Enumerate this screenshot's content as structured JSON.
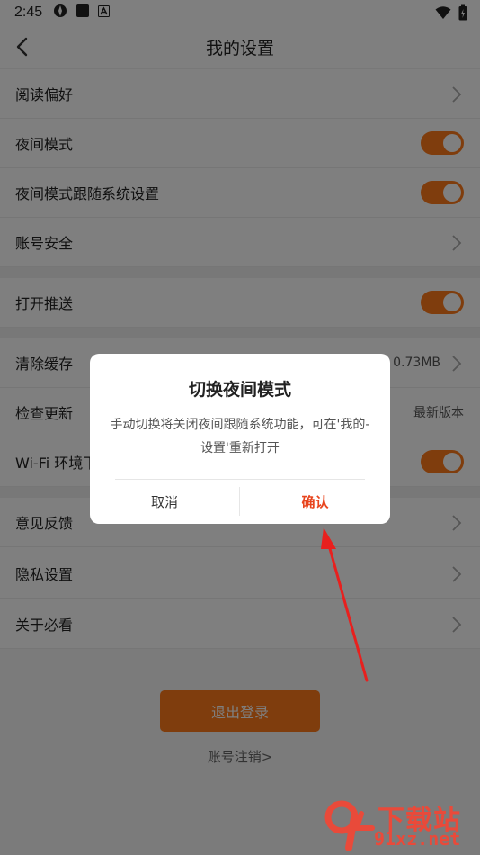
{
  "status_bar": {
    "time": "2:45"
  },
  "header": {
    "title": "我的设置"
  },
  "settings": {
    "reading_pref": "阅读偏好",
    "night_mode": "夜间模式",
    "night_follow_system": "夜间模式跟随系统设置",
    "account_security": "账号安全",
    "push": "打开推送",
    "clear_cache": "清除缓存",
    "cache_size": "0.73MB",
    "check_update": "检查更新",
    "update_status": "最新版本",
    "wifi": "Wi-Fi 环境下",
    "feedback": "意见反馈",
    "privacy": "隐私设置",
    "about": "关于必看"
  },
  "logout_label": "退出登录",
  "account_cancel_label": "账号注销>",
  "dialog": {
    "title": "切换夜间模式",
    "message": "手动切换将关闭夜间跟随系统功能，可在'我的-设置'重新打开",
    "cancel_label": "取消",
    "confirm_label": "确认"
  },
  "watermark": {
    "brand_cn": "下载站",
    "url": "91xz.net",
    "logo": "9f"
  },
  "colors": {
    "accent": "#ff7a1a",
    "confirm": "#e8451e",
    "arrow": "#e8201e"
  }
}
